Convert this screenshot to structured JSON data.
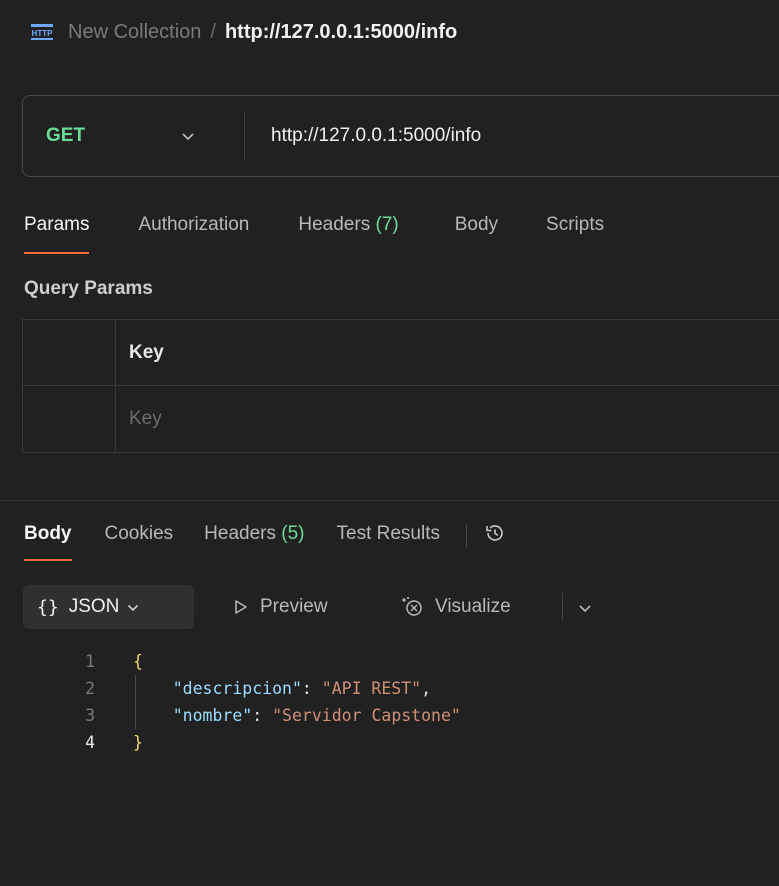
{
  "breadcrumb": {
    "icon": "http-request-icon",
    "collection": "New Collection",
    "separator": "/",
    "request": "http://127.0.0.1:5000/info"
  },
  "request": {
    "method": "GET",
    "url": "http://127.0.0.1:5000/info"
  },
  "request_tabs": [
    {
      "label": "Params",
      "count": ""
    },
    {
      "label": "Authorization",
      "count": ""
    },
    {
      "label": "Headers",
      "count": "(7)"
    },
    {
      "label": "Body",
      "count": ""
    },
    {
      "label": "Scripts",
      "count": ""
    }
  ],
  "query_params": {
    "title": "Query Params",
    "header_key": "Key",
    "key_placeholder": "Key"
  },
  "response_tabs": [
    {
      "label": "Body",
      "count": ""
    },
    {
      "label": "Cookies",
      "count": ""
    },
    {
      "label": "Headers",
      "count": "(5)"
    },
    {
      "label": "Test Results",
      "count": ""
    }
  ],
  "response_toolbar": {
    "format_braces": "{}",
    "format": "JSON",
    "preview": "Preview",
    "visualize": "Visualize"
  },
  "response_body": {
    "line_numbers": [
      "1",
      "2",
      "3",
      "4"
    ],
    "open_brace": "{",
    "close_brace": "}",
    "fields": [
      {
        "key": "\"descripcion\"",
        "value": "\"API REST\"",
        "trail": ","
      },
      {
        "key": "\"nombre\"",
        "value": "\"Servidor Capstone\"",
        "trail": ""
      }
    ]
  },
  "colors": {
    "accent": "#ff6c37",
    "method_get": "#6bdd9a",
    "json_key": "#9cdcfe",
    "json_string": "#ce9178"
  }
}
